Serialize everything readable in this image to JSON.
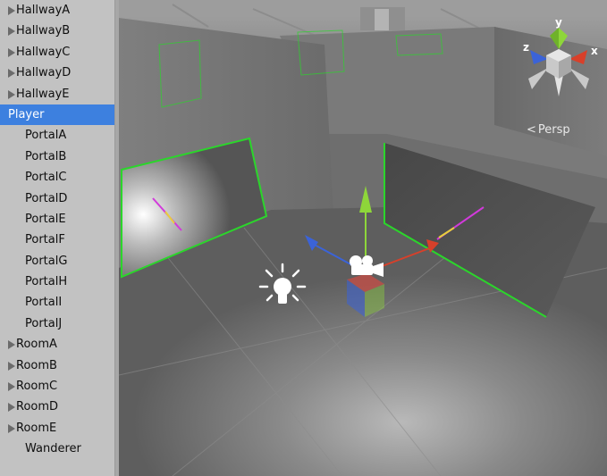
{
  "hierarchy": {
    "items": [
      {
        "label": "HallwayA",
        "expandable": true,
        "selected": false
      },
      {
        "label": "HallwayB",
        "expandable": true,
        "selected": false
      },
      {
        "label": "HallwayC",
        "expandable": true,
        "selected": false
      },
      {
        "label": "HallwayD",
        "expandable": true,
        "selected": false
      },
      {
        "label": "HallwayE",
        "expandable": true,
        "selected": false
      },
      {
        "label": "Player",
        "expandable": false,
        "selected": true
      },
      {
        "label": "PortalA",
        "expandable": false,
        "selected": false
      },
      {
        "label": "PortalB",
        "expandable": false,
        "selected": false
      },
      {
        "label": "PortalC",
        "expandable": false,
        "selected": false
      },
      {
        "label": "PortalD",
        "expandable": false,
        "selected": false
      },
      {
        "label": "PortalE",
        "expandable": false,
        "selected": false
      },
      {
        "label": "PortalF",
        "expandable": false,
        "selected": false
      },
      {
        "label": "PortalG",
        "expandable": false,
        "selected": false
      },
      {
        "label": "PortalH",
        "expandable": false,
        "selected": false
      },
      {
        "label": "PortalI",
        "expandable": false,
        "selected": false
      },
      {
        "label": "PortalJ",
        "expandable": false,
        "selected": false
      },
      {
        "label": "RoomA",
        "expandable": true,
        "selected": false
      },
      {
        "label": "RoomB",
        "expandable": true,
        "selected": false
      },
      {
        "label": "RoomC",
        "expandable": true,
        "selected": false
      },
      {
        "label": "RoomD",
        "expandable": true,
        "selected": false
      },
      {
        "label": "RoomE",
        "expandable": true,
        "selected": false
      },
      {
        "label": "Wanderer",
        "expandable": false,
        "selected": false
      }
    ]
  },
  "scene": {
    "projection_label": "Persp",
    "gizmo": {
      "y_label": "y",
      "x_label": "x",
      "z_label": "z"
    },
    "colors": {
      "selection_outline": "#2bd62b",
      "axis_x": "#d8402a",
      "axis_y": "#8ed63a",
      "axis_z": "#3b63d8",
      "selected_row": "#3d80df"
    }
  }
}
